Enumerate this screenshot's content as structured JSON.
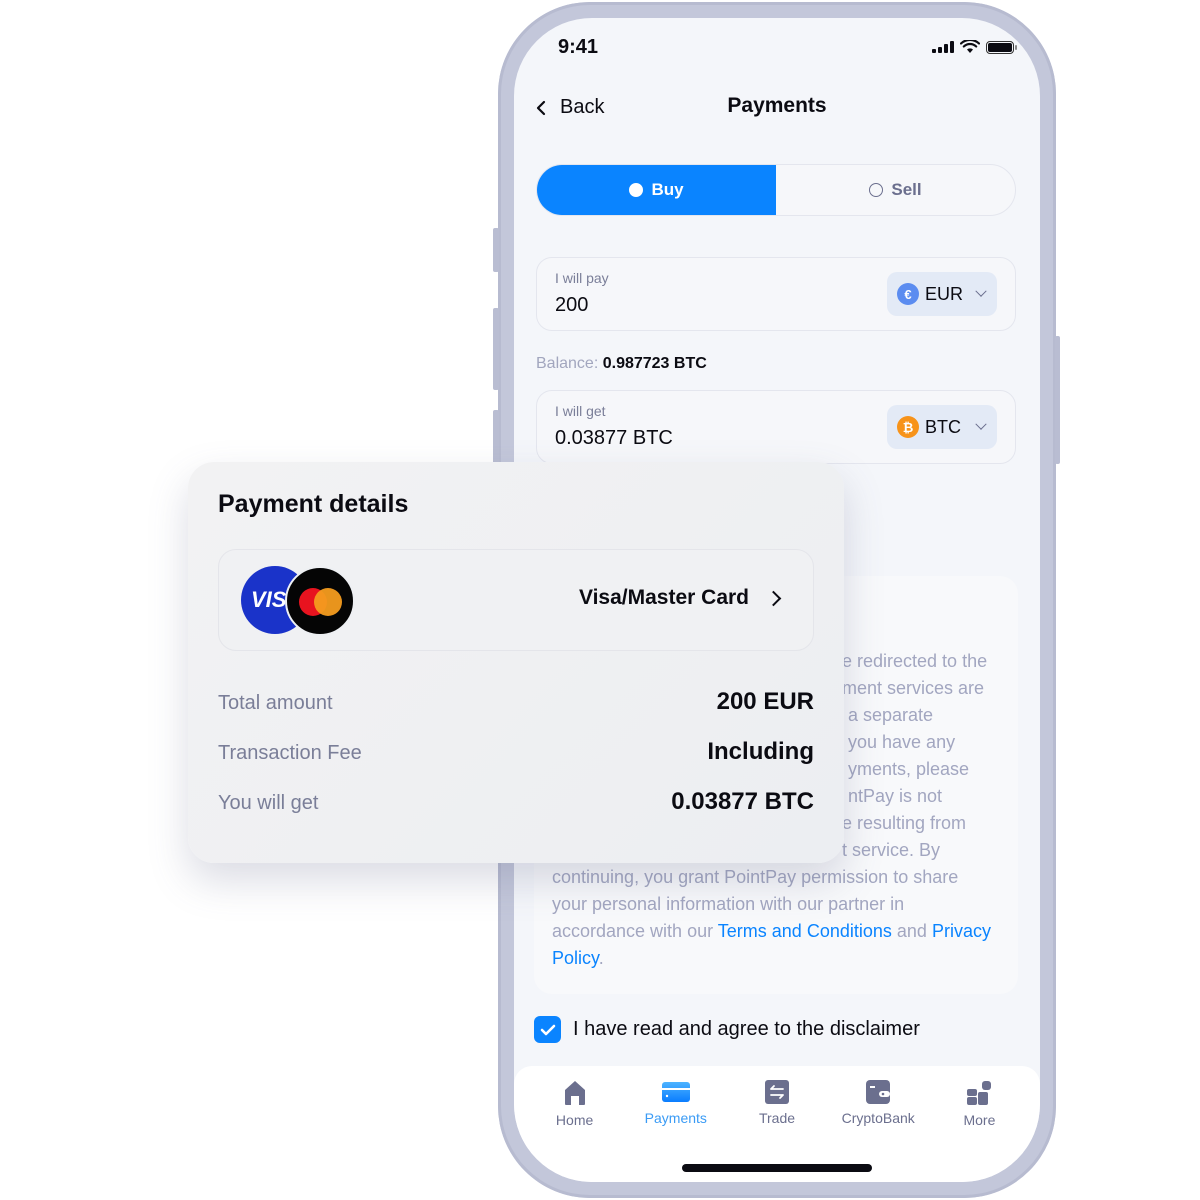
{
  "status_bar": {
    "time": "9:41"
  },
  "header": {
    "back_label": "Back",
    "title": "Payments"
  },
  "mode_toggle": {
    "options": [
      {
        "label": "Buy",
        "selected": true
      },
      {
        "label": "Sell",
        "selected": false
      }
    ]
  },
  "pay_field": {
    "label": "I will pay",
    "value": "200",
    "currency": "EUR",
    "currency_icon": "euro-icon",
    "currency_color": "#5b8cf0"
  },
  "balance": {
    "label": "Balance:",
    "value": "0.987723 BTC"
  },
  "get_field": {
    "label": "I will get",
    "value": "0.03877 BTC",
    "currency": "BTC",
    "currency_icon": "bitcoin-icon",
    "currency_color": "#f7931a"
  },
  "disclaimer": {
    "visible_text_fragments": [
      "e redirected to the",
      "ment services are",
      "a separate",
      "you have any",
      "yments, please",
      "ntPay is not",
      "e resulting from",
      "t service. By"
    ],
    "text_main": "continuing, you grant PointPay permission to share your personal information with our partner in accordance with our",
    "terms_link": "Terms and Conditions",
    "and_word": "and",
    "privacy_link": "Privacy Policy",
    "period": "."
  },
  "agree": {
    "label": "I have read and agree to the disclaimer",
    "checked": true
  },
  "tab_bar": {
    "items": [
      {
        "label": "Home",
        "icon": "home-icon",
        "active": false
      },
      {
        "label": "Payments",
        "icon": "card-icon",
        "active": true
      },
      {
        "label": "Trade",
        "icon": "swap-icon",
        "active": false
      },
      {
        "label": "CryptoBank",
        "icon": "wallet-icon",
        "active": false
      },
      {
        "label": "More",
        "icon": "grid-icon",
        "active": false
      }
    ]
  },
  "payment_details": {
    "title": "Payment details",
    "method": {
      "label": "Visa/Master Card",
      "visa_text": "VIS"
    },
    "rows": [
      {
        "label": "Total amount",
        "value": "200 EUR"
      },
      {
        "label": "Transaction Fee",
        "value": "Including"
      },
      {
        "label": "You will get",
        "value": "0.03877 BTC"
      }
    ]
  },
  "colors": {
    "accent": "#0a84ff",
    "muted_text": "#7a7e98",
    "frame": "#c3c7da"
  }
}
